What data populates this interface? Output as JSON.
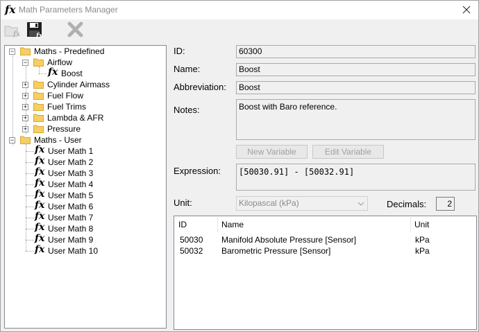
{
  "window": {
    "title": "Math Parameters Manager",
    "icon": "fx-icon"
  },
  "toolbar": [
    {
      "name": "new-fx-button",
      "icon": "folder-fx-icon",
      "enabled": false
    },
    {
      "name": "save-button",
      "icon": "floppy-disk-icon",
      "enabled": true
    },
    {
      "name": "delete-button",
      "icon": "x-cross-icon",
      "enabled": false
    }
  ],
  "tree": {
    "root1": {
      "label": "Maths - Predefined",
      "expander": "−"
    },
    "airflow": {
      "label": "Airflow",
      "expander": "−"
    },
    "boost": {
      "label": "Boost"
    },
    "cylinder": {
      "label": "Cylinder Airmass",
      "expander": "+"
    },
    "fuelflow": {
      "label": "Fuel Flow",
      "expander": "+"
    },
    "fueltrims": {
      "label": "Fuel Trims",
      "expander": "+"
    },
    "lambda": {
      "label": "Lambda & AFR",
      "expander": "+"
    },
    "pressure": {
      "label": "Pressure",
      "expander": "+"
    },
    "root2": {
      "label": "Maths - User",
      "expander": "−"
    },
    "user_maths": [
      "User Math 1",
      "User Math 2",
      "User Math 3",
      "User Math 4",
      "User Math 5",
      "User Math 6",
      "User Math 7",
      "User Math 8",
      "User Math 9",
      "User Math 10"
    ]
  },
  "form": {
    "id_label": "ID:",
    "id_value": "60300",
    "name_label": "Name:",
    "name_value": "Boost",
    "abbrev_label": "Abbreviation:",
    "abbrev_value": "Boost",
    "notes_label": "Notes:",
    "notes_value": "Boost with Baro reference.",
    "new_variable": "New Variable",
    "edit_variable": "Edit Variable",
    "expression_label": "Expression:",
    "expression_value": "[50030.91] - [50032.91]",
    "unit_label": "Unit:",
    "unit_value": "Kilopascal (kPa)",
    "decimals_label": "Decimals:",
    "decimals_value": "2"
  },
  "variables": {
    "columns": [
      "ID",
      "Name",
      "Unit"
    ],
    "rows": [
      {
        "id": "50030",
        "name": "Manifold Absolute Pressure [Sensor]",
        "unit": "kPa"
      },
      {
        "id": "50032",
        "name": "Barometric Pressure [Sensor]",
        "unit": "kPa"
      }
    ]
  },
  "colors": {
    "accent_folder": "#f5cf63",
    "folder_edge": "#d9a634"
  }
}
